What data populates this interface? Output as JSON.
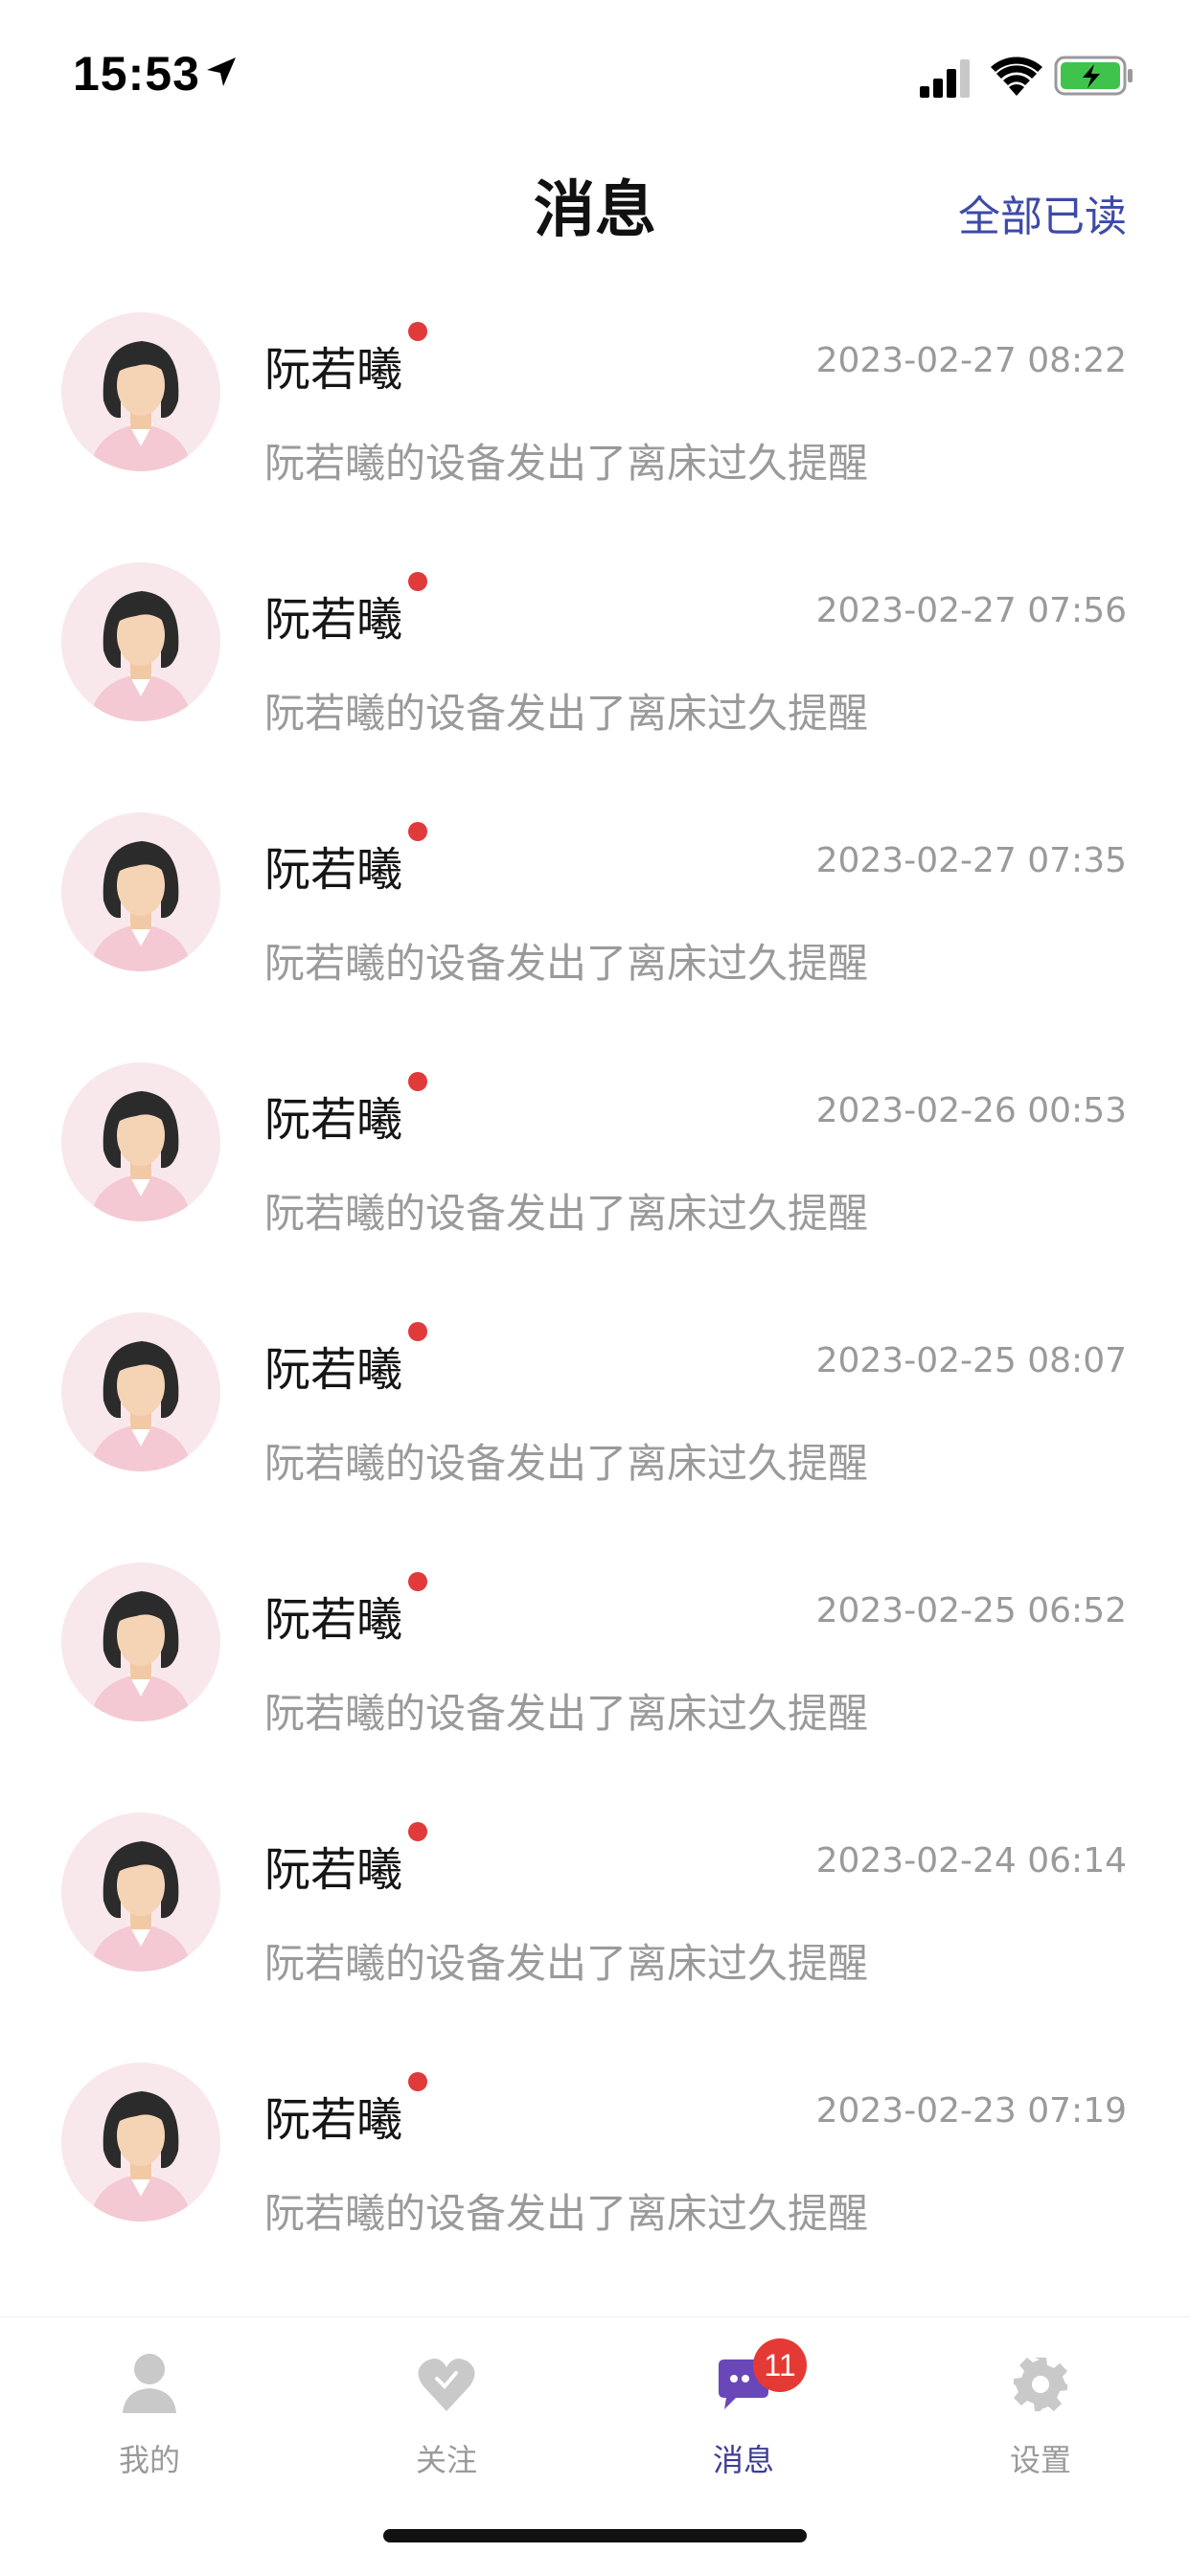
{
  "status_bar": {
    "time": "15:53",
    "icons": [
      "location-arrow-icon",
      "cellular-signal-icon",
      "wifi-icon",
      "battery-charging-icon"
    ]
  },
  "header": {
    "title": "消息",
    "mark_all_read": "全部已读"
  },
  "colors": {
    "accent": "#3d4aa8",
    "active_tab": "#3f3c96",
    "unread_dot": "#e03a3a",
    "badge": "#e53935",
    "secondary_text": "#9a9a9a"
  },
  "messages": [
    {
      "name": "阮若曦",
      "time": "2023-02-27 08:22",
      "text": "阮若曦的设备发出了离床过久提醒",
      "unread": true
    },
    {
      "name": "阮若曦",
      "time": "2023-02-27 07:56",
      "text": "阮若曦的设备发出了离床过久提醒",
      "unread": true
    },
    {
      "name": "阮若曦",
      "time": "2023-02-27 07:35",
      "text": "阮若曦的设备发出了离床过久提醒",
      "unread": true
    },
    {
      "name": "阮若曦",
      "time": "2023-02-26 00:53",
      "text": "阮若曦的设备发出了离床过久提醒",
      "unread": true
    },
    {
      "name": "阮若曦",
      "time": "2023-02-25 08:07",
      "text": "阮若曦的设备发出了离床过久提醒",
      "unread": true
    },
    {
      "name": "阮若曦",
      "time": "2023-02-25 06:52",
      "text": "阮若曦的设备发出了离床过久提醒",
      "unread": true
    },
    {
      "name": "阮若曦",
      "time": "2023-02-24 06:14",
      "text": "阮若曦的设备发出了离床过久提醒",
      "unread": true
    },
    {
      "name": "阮若曦",
      "time": "2023-02-23 07:19",
      "text": "阮若曦的设备发出了离床过久提醒",
      "unread": true
    }
  ],
  "tabbar": {
    "tabs": [
      {
        "label": "我的",
        "icon": "person-icon",
        "active": false
      },
      {
        "label": "关注",
        "icon": "heart-icon",
        "active": false
      },
      {
        "label": "消息",
        "icon": "chat-bubble-icon",
        "active": true,
        "badge": "11"
      },
      {
        "label": "设置",
        "icon": "gear-icon",
        "active": false
      }
    ]
  }
}
